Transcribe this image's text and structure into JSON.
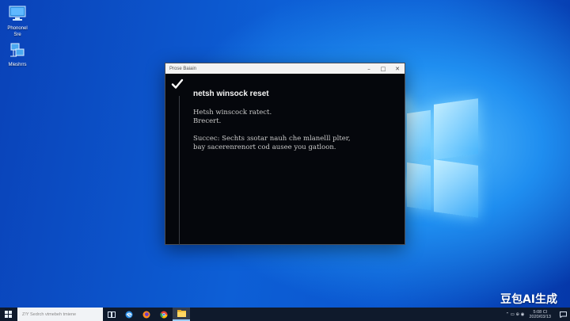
{
  "desktop": {
    "icons": [
      {
        "label_line1": "Phononel",
        "label_line2": "Sre",
        "icon": "monitor-icon"
      },
      {
        "label_line1": "Mleshrrs",
        "icon": "network-icon"
      }
    ]
  },
  "window": {
    "title": "Prose Baiain",
    "controls": {
      "minimize": "–",
      "maximize": "□",
      "close": "✕"
    },
    "icon": "checkmark-icon",
    "command_heading": "netsh winsock reset",
    "output_lines": [
      "Hetsh winscock ratect.",
      "Brecert.",
      "",
      "Succec: Sechts ɜsotar nauh che mlanelll plter,",
      "bay sacerenrenort cod ausee you gatloon."
    ]
  },
  "taskbar": {
    "search_placeholder": "Z!Y Sedrch vtmebeh tmiene",
    "apps": [
      "task-view-icon",
      "edge-icon",
      "firefox-icon",
      "chrome-icon",
      "file-explorer-icon"
    ],
    "tray_icons": "⌃ ▭ ⊕ ◉",
    "clock_time": "5:08 Cl",
    "clock_date": "2020/03/13",
    "notification_icon": "notification-icon"
  },
  "watermark": "豆包AI生成",
  "colors": {
    "desktop_blue": "#0d5fd6",
    "console_bg": "#05070c",
    "taskbar_bg": "#0f1a2c"
  }
}
